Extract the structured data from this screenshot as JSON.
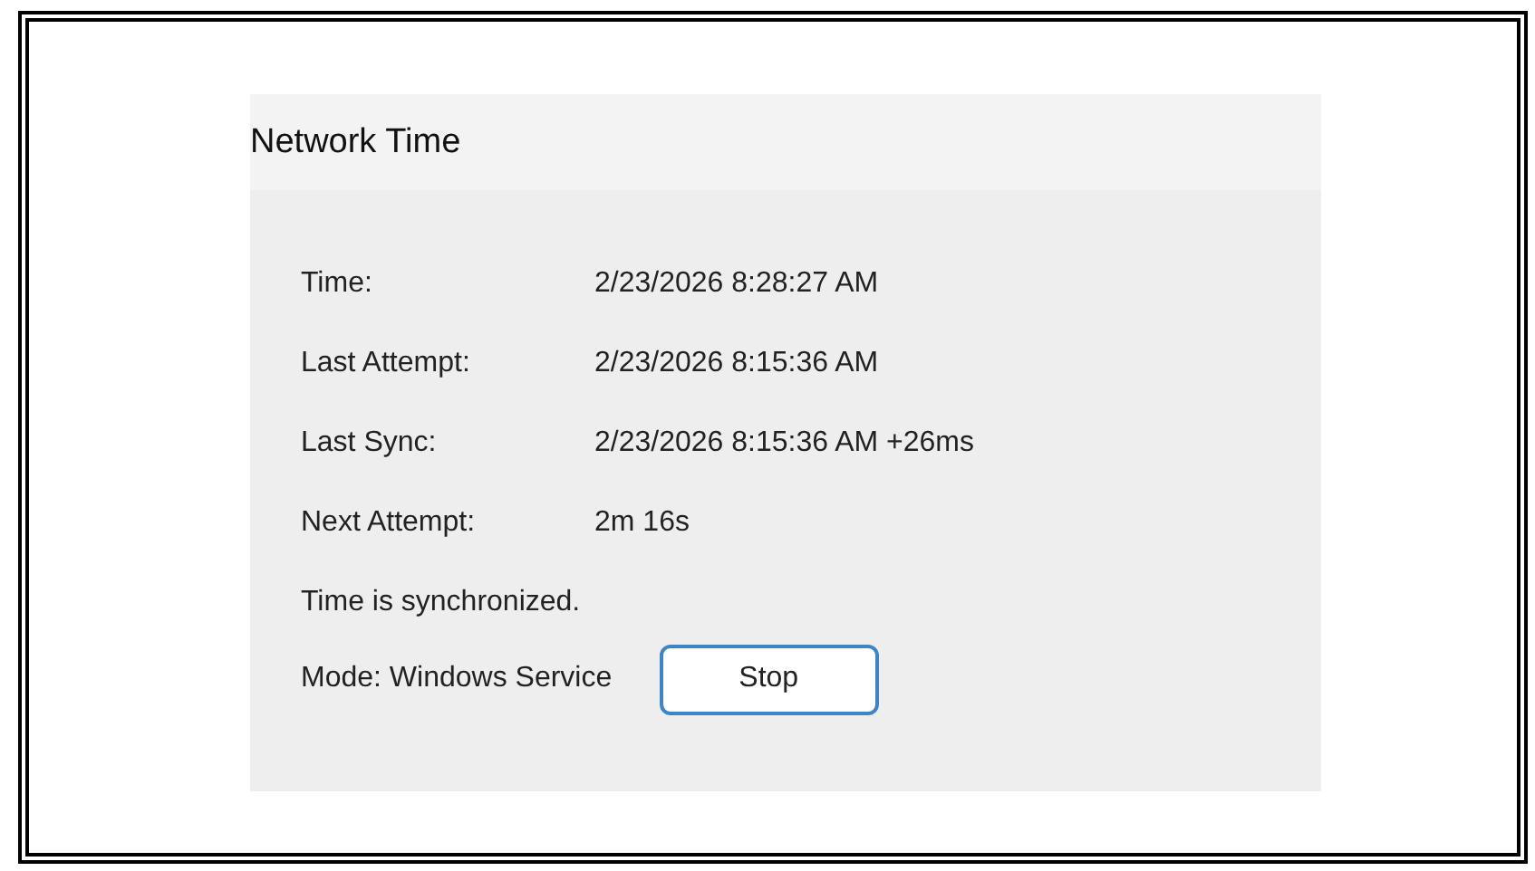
{
  "panel": {
    "title": "Network Time"
  },
  "fields": [
    {
      "label": "Time:",
      "value": "2/23/2026 8:28:27 AM"
    },
    {
      "label": "Last Attempt:",
      "value": "2/23/2026 8:15:36 AM"
    },
    {
      "label": "Last Sync:",
      "value": "2/23/2026 8:15:36 AM +26ms"
    },
    {
      "label": "Next Attempt:",
      "value": "2m 16s"
    }
  ],
  "status": "Time is synchronized.",
  "mode": "Mode: Windows Service",
  "buttons": [
    "Stop"
  ]
}
